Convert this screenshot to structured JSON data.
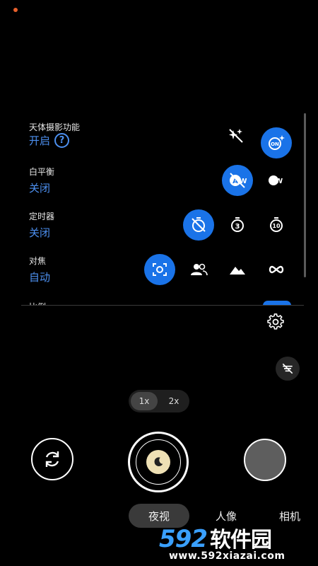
{
  "settings": {
    "rows": [
      {
        "title": "天体摄影功能",
        "value": "开启",
        "help": "?"
      },
      {
        "title": "白平衡",
        "value": "关闭"
      },
      {
        "title": "定时器",
        "value": "关闭"
      },
      {
        "title": "对焦",
        "value": "自动"
      }
    ],
    "peek_title": "比例",
    "icons": {
      "astro_off": "sparkle-off-icon",
      "astro_on": "sparkle-on-icon",
      "wb_off": "awb-off-icon",
      "wb_auto": "awb-icon",
      "timer_off": "timer-off-icon",
      "timer_3": "3",
      "timer_10": "10",
      "focus_auto": "focus-auto-icon",
      "focus_face": "people-icon",
      "focus_landscape": "mountain-icon",
      "focus_infinity": "infinity-icon"
    },
    "labels": {
      "on_badge": "ON",
      "awb": "AW"
    }
  },
  "zoom": {
    "options": [
      "1x",
      "2x"
    ],
    "selected": "1x"
  },
  "modes": [
    "夜视",
    "人像",
    "相机"
  ],
  "selected_mode": "夜视",
  "colors": {
    "accent": "#1a73e8",
    "value_text": "#4d90f0",
    "status_dot": "#e8602c"
  },
  "watermark": {
    "logo": "592",
    "logo_cn": "软件园",
    "url": "www.592xiazai.com"
  }
}
